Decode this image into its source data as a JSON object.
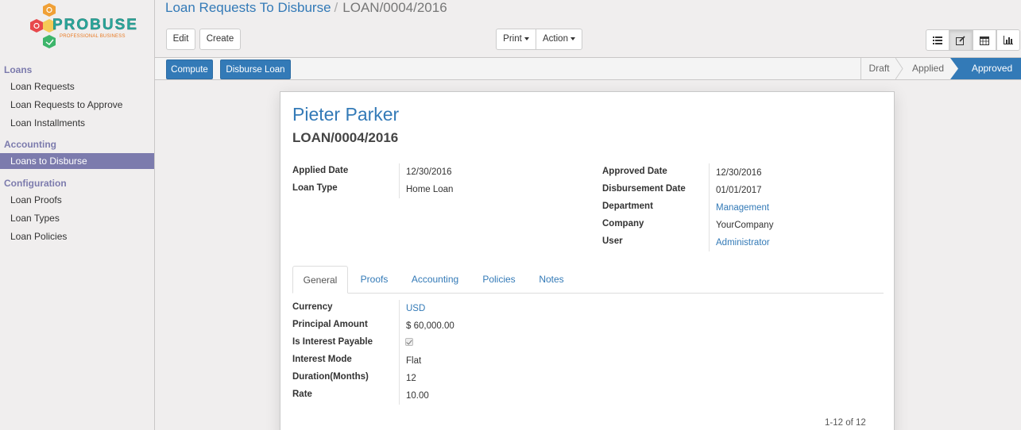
{
  "logo": {
    "text": "PROBUSE",
    "subtitle": "PROFESSIONAL BUSINESS"
  },
  "sidebar": {
    "sections": [
      {
        "title": "Loans",
        "items": [
          "Loan Requests",
          "Loan Requests to Approve",
          "Loan Installments"
        ]
      },
      {
        "title": "Accounting",
        "items": [
          "Loans to Disburse"
        ]
      },
      {
        "title": "Configuration",
        "items": [
          "Loan Proofs",
          "Loan Types",
          "Loan Policies"
        ]
      }
    ],
    "active_item": "Loans to Disburse"
  },
  "breadcrumb": {
    "parent": "Loan Requests To Disburse",
    "separator": "/",
    "current": "LOAN/0004/2016"
  },
  "toolbar": {
    "edit": "Edit",
    "create": "Create",
    "print": "Print",
    "action": "Action"
  },
  "view_switcher": [
    {
      "icon": "list-icon",
      "active": false
    },
    {
      "icon": "form-edit-icon",
      "active": true
    },
    {
      "icon": "calendar-icon",
      "active": false
    },
    {
      "icon": "bar-chart-icon",
      "active": false
    }
  ],
  "statusbar": {
    "buttons": {
      "compute": "Compute",
      "disburse": "Disburse Loan"
    },
    "stages": [
      "Draft",
      "Applied",
      "Approved"
    ],
    "active_stage": "Approved",
    "accent": "#337ab7"
  },
  "record": {
    "name": "Pieter Parker",
    "ref": "LOAN/0004/2016",
    "left": {
      "applied_date_label": "Applied Date",
      "applied_date": "12/30/2016",
      "loan_type_label": "Loan Type",
      "loan_type": "Home Loan"
    },
    "right": {
      "approved_date_label": "Approved Date",
      "approved_date": "12/30/2016",
      "disbursement_date_label": "Disbursement Date",
      "disbursement_date": "01/01/2017",
      "department_label": "Department",
      "department": "Management",
      "company_label": "Company",
      "company": "YourCompany",
      "user_label": "User",
      "user": "Administrator"
    }
  },
  "tabs": [
    "General",
    "Proofs",
    "Accounting",
    "Policies",
    "Notes"
  ],
  "active_tab": "General",
  "general": {
    "currency_label": "Currency",
    "currency": "USD",
    "principal_label": "Principal Amount",
    "principal": "$ 60,000.00",
    "interest_payable_label": "Is Interest Payable",
    "interest_payable": true,
    "interest_mode_label": "Interest Mode",
    "interest_mode": "Flat",
    "duration_label": "Duration(Months)",
    "duration": "12",
    "rate_label": "Rate",
    "rate": "10.00"
  },
  "pager": "1-12 of 12"
}
